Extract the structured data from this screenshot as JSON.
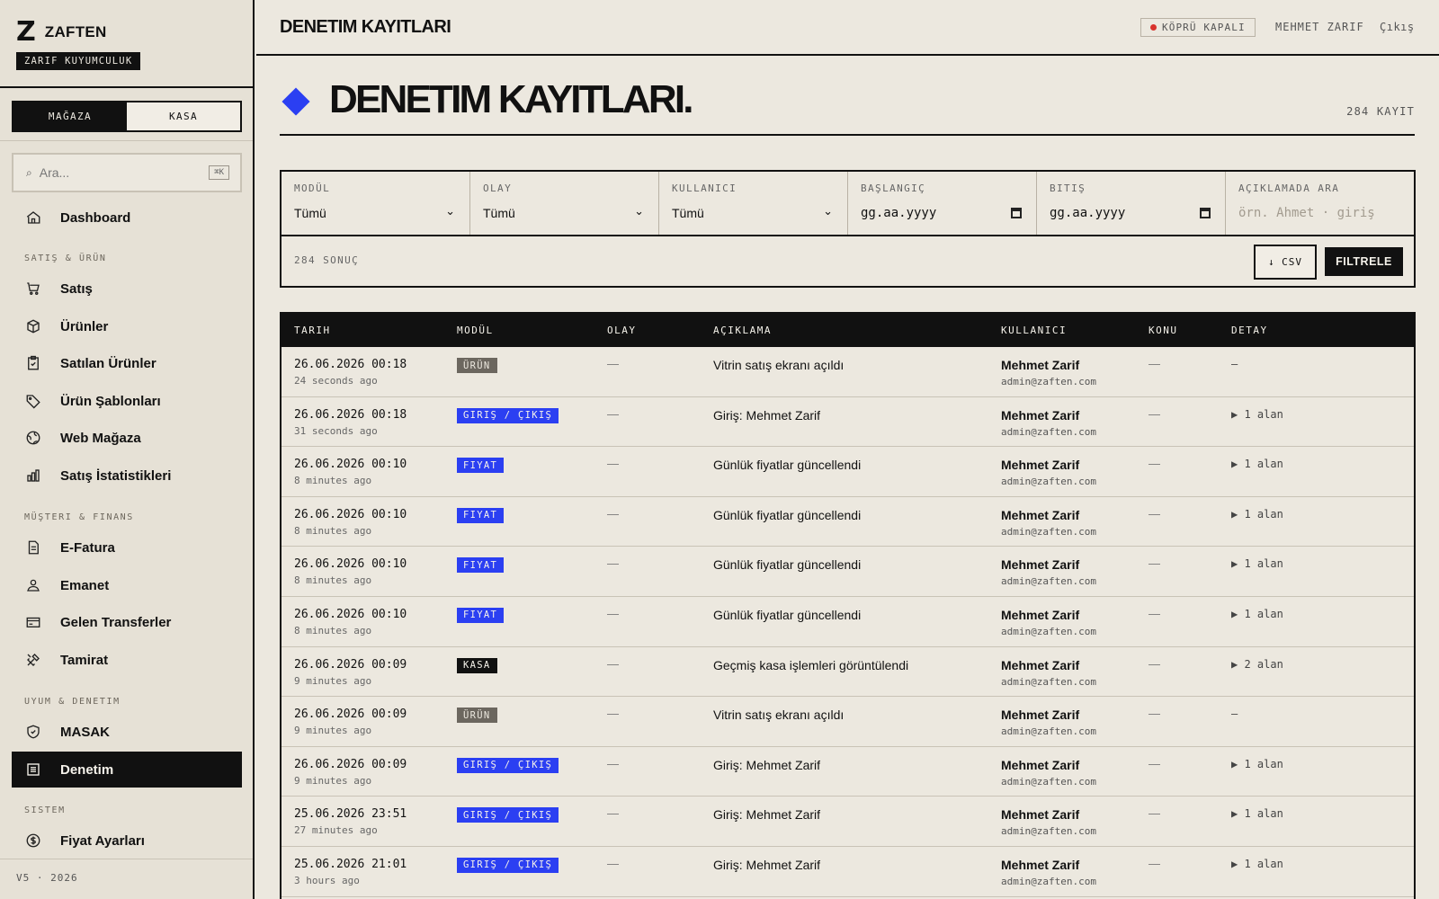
{
  "brand": {
    "logo": "Z",
    "name": "ZAFTEN",
    "subtitle": "ZARIF KUYUMCULUK"
  },
  "segments": {
    "store": "MAĞAZA",
    "cash": "KASA"
  },
  "search": {
    "placeholder": "Ara...",
    "shortcut": "⌘K"
  },
  "sidebar": {
    "sections": [
      "SATIŞ & ÜRÜN",
      "MÜŞTERI & FINANS",
      "UYUM & DENETIM",
      "SISTEM"
    ],
    "items": [
      "Dashboard",
      "Satış",
      "Ürünler",
      "Satılan Ürünler",
      "Ürün Şablonları",
      "Web Mağaza",
      "Satış İstatistikleri",
      "E-Fatura",
      "Emanet",
      "Gelen Transferler",
      "Tamirat",
      "MASAK",
      "Denetim",
      "Fiyat Ayarları"
    ],
    "footer": "V5 · 2026"
  },
  "topbar": {
    "title": "DENETIM KAYITLARI",
    "status": "KÖPRÜ KAPALI",
    "user": "MEHMET ZARIF",
    "logout": "Çıkış"
  },
  "page": {
    "title": "DENETIM KAYITLARI.",
    "count": "284 KAYIT"
  },
  "filters": {
    "module": {
      "label": "MODÜL",
      "value": "Tümü"
    },
    "event": {
      "label": "OLAY",
      "value": "Tümü"
    },
    "user": {
      "label": "KULLANICI",
      "value": "Tümü"
    },
    "start": {
      "label": "BAŞLANGIÇ",
      "value": "gg.aa.yyyy"
    },
    "end": {
      "label": "BITIŞ",
      "value": "gg.aa.yyyy"
    },
    "query": {
      "label": "AÇIKLAMADA ARA",
      "placeholder": "örn. Ahmet · giriş"
    },
    "results": "284 SONUÇ",
    "csv": "↓ CSV",
    "apply": "FILTRELE"
  },
  "table": {
    "headers": [
      "TARIH",
      "MODÜL",
      "OLAY",
      "AÇIKLAMA",
      "KULLANICI",
      "KONU",
      "DETAY"
    ],
    "rows": [
      {
        "date": "26.06.2026 00:18",
        "ago": "24 seconds ago",
        "module": "ÜRÜN",
        "event": "—",
        "desc": "Vitrin satış ekranı açıldı",
        "user": "Mehmet Zarif",
        "email": "admin@zaften.com",
        "subject": "—",
        "detail": "—"
      },
      {
        "date": "26.06.2026 00:18",
        "ago": "31 seconds ago",
        "module": "GIRIŞ / ÇIKIŞ",
        "event": "—",
        "desc": "Giriş: Mehmet Zarif",
        "user": "Mehmet Zarif",
        "email": "admin@zaften.com",
        "subject": "—",
        "detail": "▶ 1 alan"
      },
      {
        "date": "26.06.2026 00:10",
        "ago": "8 minutes ago",
        "module": "FIYAT",
        "event": "—",
        "desc": "Günlük fiyatlar güncellendi",
        "user": "Mehmet Zarif",
        "email": "admin@zaften.com",
        "subject": "—",
        "detail": "▶ 1 alan"
      },
      {
        "date": "26.06.2026 00:10",
        "ago": "8 minutes ago",
        "module": "FIYAT",
        "event": "—",
        "desc": "Günlük fiyatlar güncellendi",
        "user": "Mehmet Zarif",
        "email": "admin@zaften.com",
        "subject": "—",
        "detail": "▶ 1 alan"
      },
      {
        "date": "26.06.2026 00:10",
        "ago": "8 minutes ago",
        "module": "FIYAT",
        "event": "—",
        "desc": "Günlük fiyatlar güncellendi",
        "user": "Mehmet Zarif",
        "email": "admin@zaften.com",
        "subject": "—",
        "detail": "▶ 1 alan"
      },
      {
        "date": "26.06.2026 00:10",
        "ago": "8 minutes ago",
        "module": "FIYAT",
        "event": "—",
        "desc": "Günlük fiyatlar güncellendi",
        "user": "Mehmet Zarif",
        "email": "admin@zaften.com",
        "subject": "—",
        "detail": "▶ 1 alan"
      },
      {
        "date": "26.06.2026 00:09",
        "ago": "9 minutes ago",
        "module": "KASA",
        "event": "—",
        "desc": "Geçmiş kasa işlemleri görüntülendi",
        "user": "Mehmet Zarif",
        "email": "admin@zaften.com",
        "subject": "—",
        "detail": "▶ 2 alan"
      },
      {
        "date": "26.06.2026 00:09",
        "ago": "9 minutes ago",
        "module": "ÜRÜN",
        "event": "—",
        "desc": "Vitrin satış ekranı açıldı",
        "user": "Mehmet Zarif",
        "email": "admin@zaften.com",
        "subject": "—",
        "detail": "—"
      },
      {
        "date": "26.06.2026 00:09",
        "ago": "9 minutes ago",
        "module": "GIRIŞ / ÇIKIŞ",
        "event": "—",
        "desc": "Giriş: Mehmet Zarif",
        "user": "Mehmet Zarif",
        "email": "admin@zaften.com",
        "subject": "—",
        "detail": "▶ 1 alan"
      },
      {
        "date": "25.06.2026 23:51",
        "ago": "27 minutes ago",
        "module": "GIRIŞ / ÇIKIŞ",
        "event": "—",
        "desc": "Giriş: Mehmet Zarif",
        "user": "Mehmet Zarif",
        "email": "admin@zaften.com",
        "subject": "—",
        "detail": "▶ 1 alan"
      },
      {
        "date": "25.06.2026 21:01",
        "ago": "3 hours ago",
        "module": "GIRIŞ / ÇIKIŞ",
        "event": "—",
        "desc": "Giriş: Mehmet Zarif",
        "user": "Mehmet Zarif",
        "email": "admin@zaften.com",
        "subject": "—",
        "detail": "▶ 1 alan"
      }
    ]
  }
}
